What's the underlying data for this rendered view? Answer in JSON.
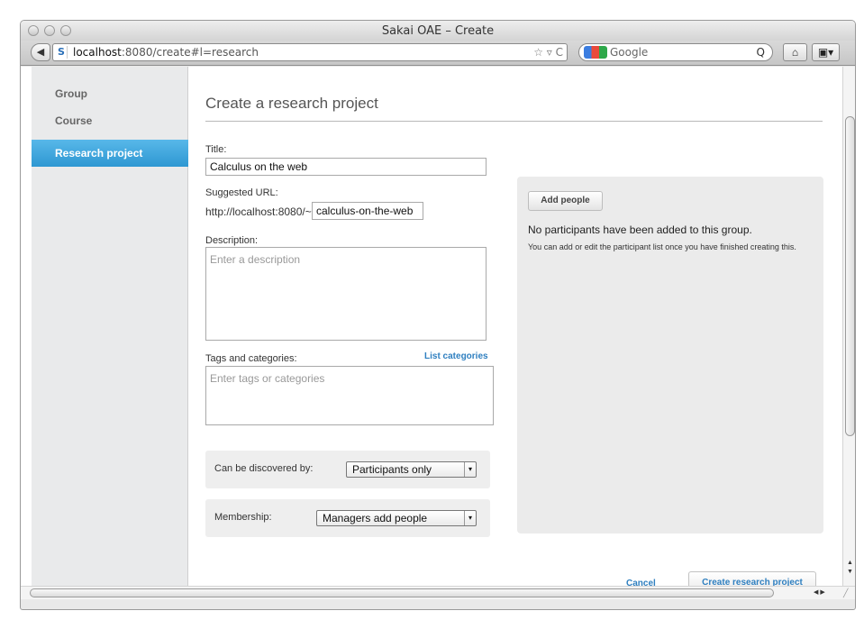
{
  "window": {
    "title": "Sakai OAE – Create"
  },
  "browser": {
    "url_host": "localhost",
    "url_rest": ":8080/create#l=research",
    "search_text": "Google",
    "back_glyph": "◀",
    "url_star_glyph": "☆ ▿ C",
    "search_glyph": "Q",
    "home_glyph": "⌂",
    "bookmark_glyph": "▣▾"
  },
  "sidebar": {
    "items": [
      {
        "label": "Group"
      },
      {
        "label": "Course"
      },
      {
        "label": "Research project"
      }
    ]
  },
  "form": {
    "page_title": "Create a research project",
    "title_label": "Title:",
    "title_value": "Calculus on the web",
    "url_label": "Suggested URL:",
    "url_prefix": "http://localhost:8080/~",
    "url_value": "calculus-on-the-web",
    "description_label": "Description:",
    "description_placeholder": "Enter a description",
    "tags_label": "Tags and categories:",
    "list_categories": "List categories",
    "tags_placeholder": "Enter tags or categories",
    "discover_label": "Can be discovered by:",
    "discover_value": "Participants only",
    "membership_label": "Membership:",
    "membership_value": "Managers add people"
  },
  "people": {
    "add_button": "Add people",
    "empty_message": "No participants have been added to this group.",
    "hint": "You can add or edit the participant list once you have finished creating this."
  },
  "actions": {
    "cancel": "Cancel",
    "create": "Create research project"
  }
}
